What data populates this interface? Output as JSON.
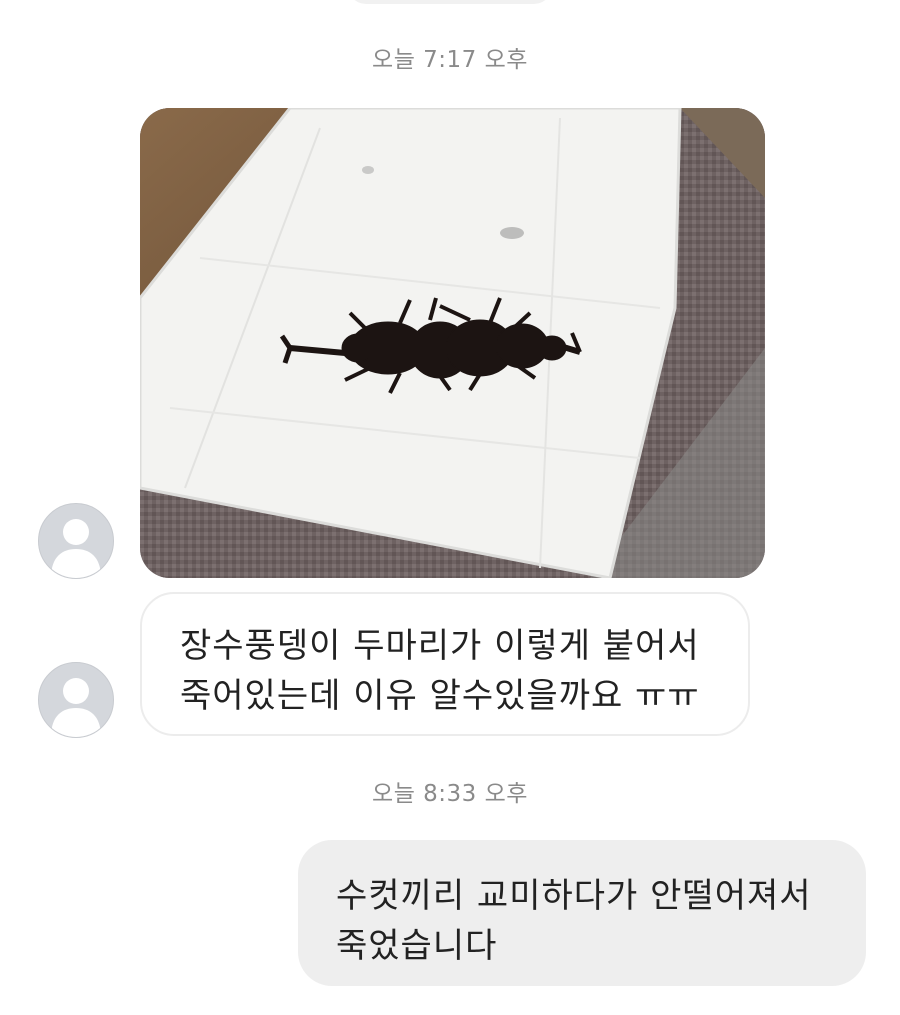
{
  "messages": [
    {
      "type": "timestamp",
      "text": "오늘 7:17 오후"
    },
    {
      "type": "image",
      "sender": "other",
      "image_description_icon": "photo-two-beetles-on-napkin"
    },
    {
      "type": "text",
      "sender": "other",
      "lines": [
        "장수풍뎅이 두마리가 이렇게 붙어서",
        "죽어있는데 이유 알수있을까요 ㅠㅠ"
      ]
    },
    {
      "type": "timestamp",
      "text": "오늘 8:33 오후"
    },
    {
      "type": "text",
      "sender": "me",
      "lines": [
        "수컷끼리 교미하다가 안떨어져서",
        "죽었습니다"
      ]
    }
  ],
  "colors": {
    "timestamp": "#8a8a8a",
    "incoming_bubble_border": "#ececec",
    "outgoing_bubble_bg": "#eeeeee",
    "avatar_bg": "#d4d7dc"
  }
}
